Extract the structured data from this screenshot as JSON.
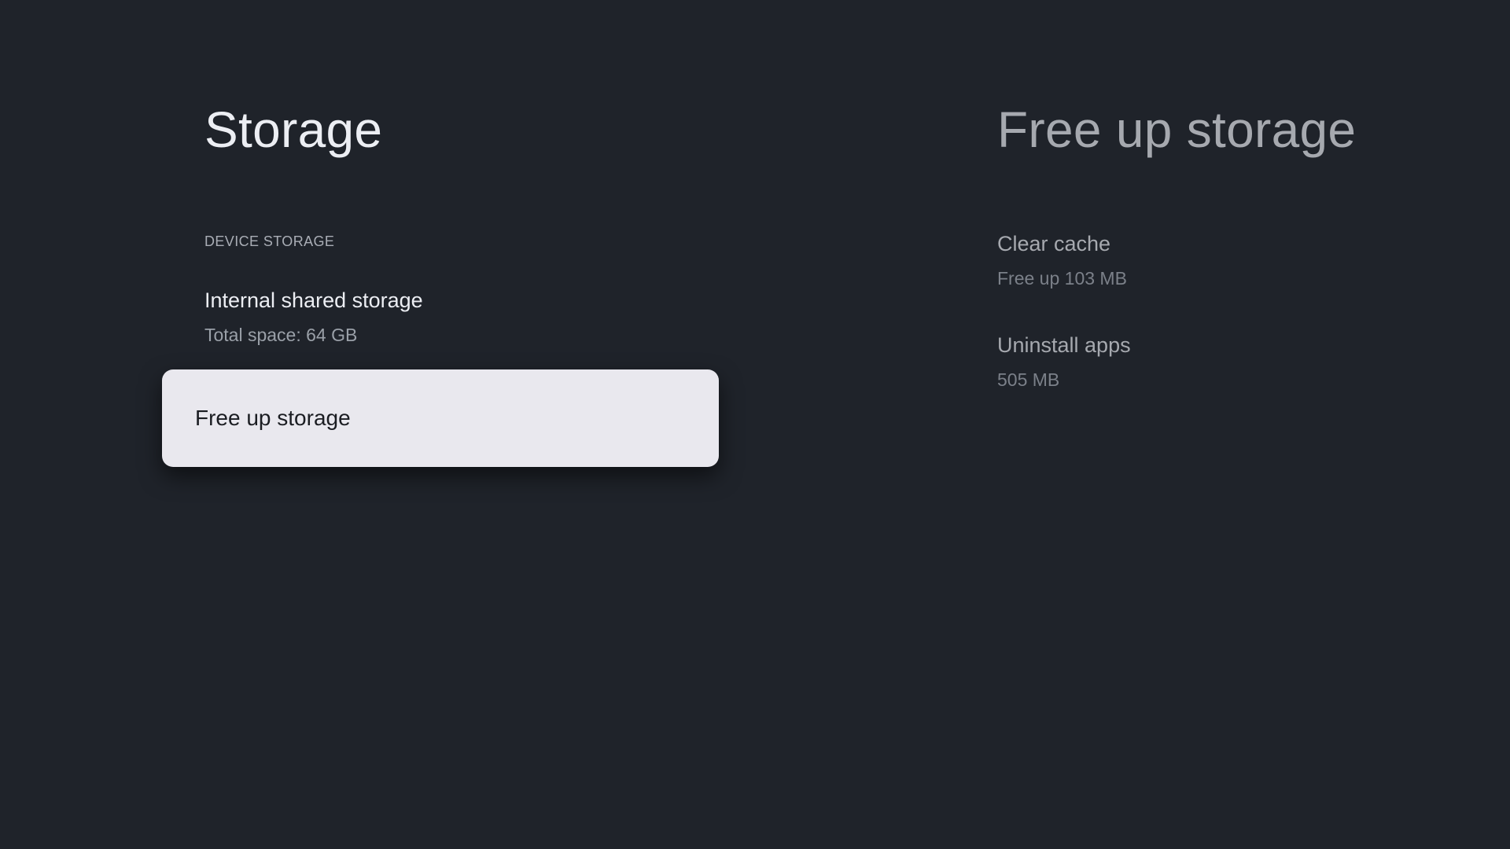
{
  "left": {
    "title": "Storage",
    "section_header": "DEVICE STORAGE",
    "internal_storage": {
      "title": "Internal shared storage",
      "subtitle": "Total space: 64 GB"
    },
    "focused_item": {
      "label": "Free up storage"
    }
  },
  "right": {
    "title": "Free up storage",
    "items": [
      {
        "title": "Clear cache",
        "subtitle": "Free up 103 MB"
      },
      {
        "title": "Uninstall apps",
        "subtitle": "505 MB"
      }
    ]
  },
  "colors": {
    "background": "#1f232a",
    "focus_card": "#e9e8ee"
  }
}
